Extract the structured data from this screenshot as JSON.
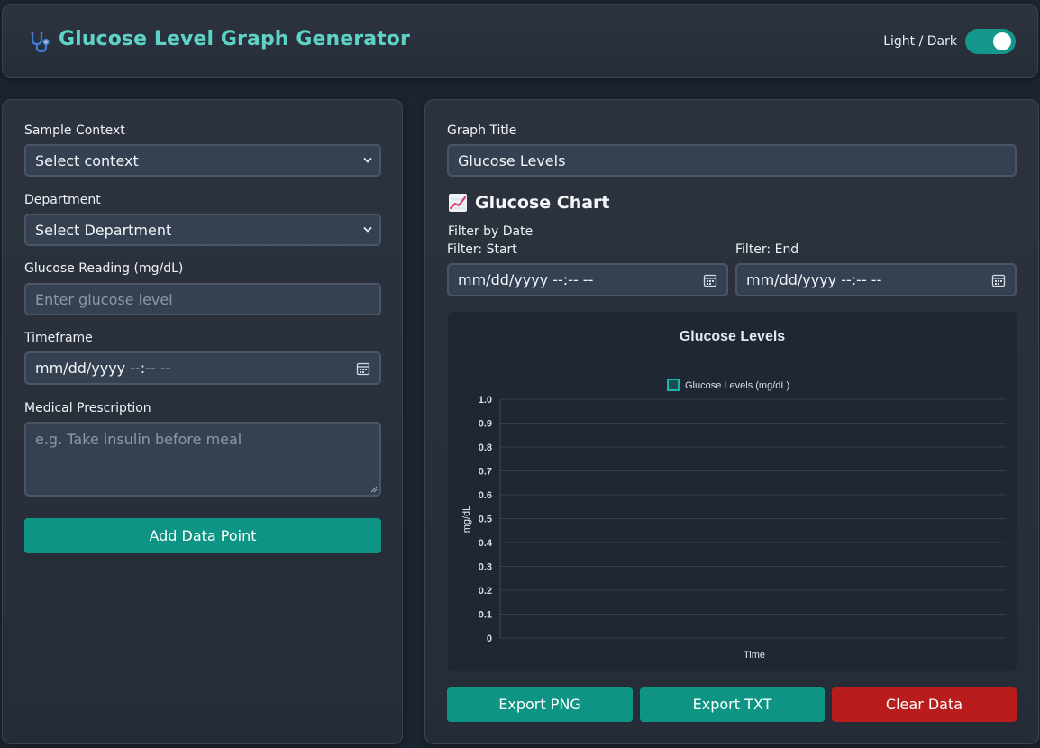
{
  "header": {
    "title": "Glucose Level Graph Generator",
    "logo_icon": "stethoscope-icon",
    "theme_label": "Light / Dark",
    "theme_toggle_on": true,
    "accent_color": "#5ed3c5"
  },
  "form": {
    "context_label": "Sample Context",
    "context_value": "Select context",
    "department_label": "Department",
    "department_value": "Select Department",
    "glucose_label": "Glucose Reading (mg/dL)",
    "glucose_placeholder": "Enter glucose level",
    "timeframe_label": "Timeframe",
    "timeframe_value": "mm/dd/yyyy --:-- --",
    "prescription_label": "Medical Prescription",
    "prescription_placeholder": "e.g. Take insulin before meal",
    "add_button": "Add Data Point"
  },
  "graph": {
    "title_label": "Graph Title",
    "title_value": "Glucose Levels",
    "section_icon": "chart-increasing-icon",
    "section_title": "Glucose Chart",
    "filter_heading": "Filter by Date",
    "filter_start_label": "Filter: Start",
    "filter_start_value": "mm/dd/yyyy --:-- --",
    "filter_end_label": "Filter: End",
    "filter_end_value": "mm/dd/yyyy --:-- --"
  },
  "chart_data": {
    "type": "line",
    "title": "Glucose Levels",
    "xlabel": "Time",
    "ylabel": "mg/dL",
    "x": [],
    "series": [
      {
        "name": "Glucose Levels (mg/dL)",
        "values": []
      }
    ],
    "ylim": [
      0,
      1.0
    ],
    "yticks": [
      "0",
      "0.1",
      "0.2",
      "0.3",
      "0.4",
      "0.5",
      "0.6",
      "0.7",
      "0.8",
      "0.9",
      "1.0"
    ],
    "grid": true,
    "legend_position": "top",
    "series_color": "#14b8a6"
  },
  "actions": {
    "export_png": "Export PNG",
    "export_txt": "Export TXT",
    "clear": "Clear Data",
    "teal_color": "#0e9484",
    "danger_color": "#b91c1c"
  }
}
